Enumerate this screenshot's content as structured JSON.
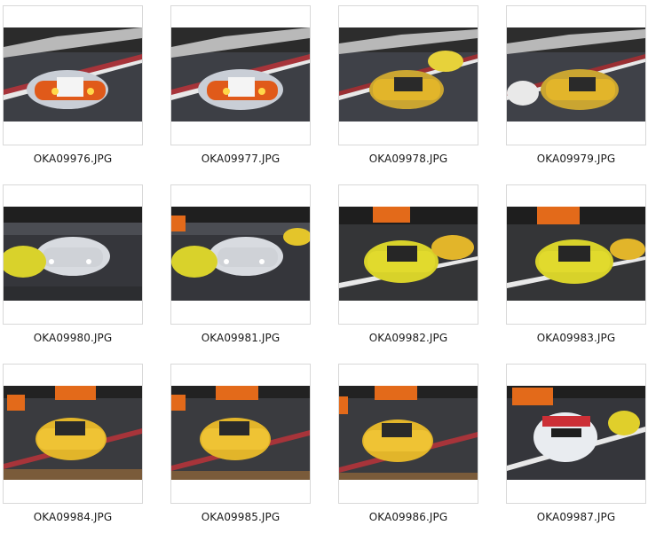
{
  "thumbnails": [
    {
      "filename": "OKA09976.JPG"
    },
    {
      "filename": "OKA09977.JPG"
    },
    {
      "filename": "OKA09978.JPG"
    },
    {
      "filename": "OKA09979.JPG"
    },
    {
      "filename": "OKA09980.JPG"
    },
    {
      "filename": "OKA09981.JPG"
    },
    {
      "filename": "OKA09982.JPG"
    },
    {
      "filename": "OKA09983.JPG"
    },
    {
      "filename": "OKA09984.JPG"
    },
    {
      "filename": "OKA09985.JPG"
    },
    {
      "filename": "OKA09986.JPG"
    },
    {
      "filename": "OKA09987.JPG"
    }
  ]
}
